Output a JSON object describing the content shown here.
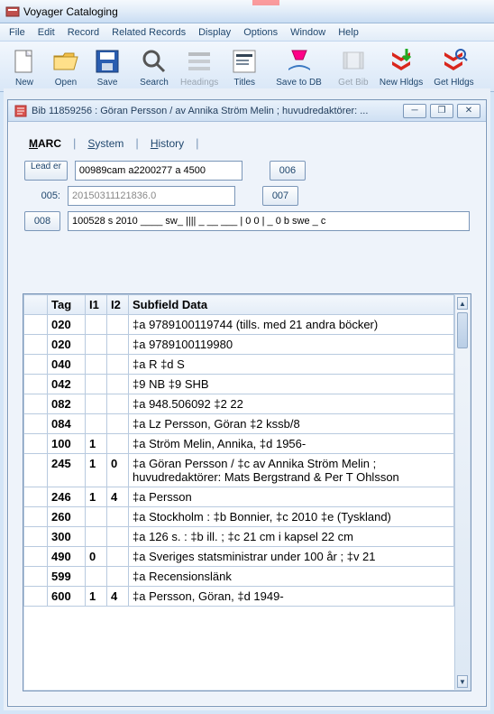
{
  "app_title": "Voyager Cataloging",
  "menus": [
    "File",
    "Edit",
    "Record",
    "Related Records",
    "Display",
    "Options",
    "Window",
    "Help"
  ],
  "toolbar": [
    {
      "name": "new-button",
      "label": "New",
      "icon": "new",
      "enabled": true
    },
    {
      "name": "open-button",
      "label": "Open",
      "icon": "open",
      "enabled": true
    },
    {
      "name": "save-button",
      "label": "Save",
      "icon": "save",
      "enabled": true
    },
    {
      "name": "search-button",
      "label": "Search",
      "icon": "search",
      "enabled": true
    },
    {
      "name": "headings-button",
      "label": "Headings",
      "icon": "headings",
      "enabled": false
    },
    {
      "name": "titles-button",
      "label": "Titles",
      "icon": "titles",
      "enabled": true
    },
    {
      "name": "savetodb-button",
      "label": "Save to DB",
      "icon": "savetodb",
      "enabled": true
    },
    {
      "name": "getbib-button",
      "label": "Get Bib",
      "icon": "getbib",
      "enabled": false
    },
    {
      "name": "newhldgs-button",
      "label": "New Hldgs",
      "icon": "newhldgs",
      "enabled": true
    },
    {
      "name": "gethldgs-button",
      "label": "Get Hldgs",
      "icon": "gethldgs",
      "enabled": true
    }
  ],
  "child": {
    "title": "Bib 11859256 : Göran Persson / av Annika Ström Melin ; huvudredaktörer: ...",
    "tabs": [
      {
        "label": "MARC",
        "underline": "M",
        "selected": true
      },
      {
        "label": "System",
        "underline": "S",
        "selected": false
      },
      {
        "label": "History",
        "underline": "H",
        "selected": false
      }
    ],
    "leader_btn": "Lead er",
    "leader_val": "00989cam a2200277 a 4500",
    "btn_006": "006",
    "lbl_005": "005:",
    "val_005": "20150311121836.0",
    "btn_007": "007",
    "btn_008": "008",
    "val_008": "100528 s 2010 ____ sw_ |||| _ __ ___ | 0 0 | _ 0 b swe _ c",
    "columns": [
      "",
      "Tag",
      "I1",
      "I2",
      "Subfield Data"
    ],
    "rows": [
      {
        "tag": "020",
        "i1": "",
        "i2": "",
        "data": "‡a 9789100119744 (tills. med 21 andra böcker)"
      },
      {
        "tag": "020",
        "i1": "",
        "i2": "",
        "data": "‡a 9789100119980"
      },
      {
        "tag": "040",
        "i1": "",
        "i2": "",
        "data": "‡a R ‡d S"
      },
      {
        "tag": "042",
        "i1": "",
        "i2": "",
        "data": "‡9 NB ‡9 SHB"
      },
      {
        "tag": "082",
        "i1": "",
        "i2": "",
        "data": "‡a 948.506092 ‡2 22"
      },
      {
        "tag": "084",
        "i1": "",
        "i2": "",
        "data": "‡a Lz Persson, Göran ‡2 kssb/8"
      },
      {
        "tag": "100",
        "i1": "1",
        "i2": "",
        "data": "‡a Ström Melin, Annika, ‡d 1956-"
      },
      {
        "tag": "245",
        "i1": "1",
        "i2": "0",
        "data": "‡a Göran Persson / ‡c av Annika Ström Melin ; huvudredaktörer: Mats Bergstrand & Per T Ohlsson"
      },
      {
        "tag": "246",
        "i1": "1",
        "i2": "4",
        "data": "‡a Persson"
      },
      {
        "tag": "260",
        "i1": "",
        "i2": "",
        "data": "‡a Stockholm : ‡b Bonnier, ‡c 2010 ‡e (Tyskland)"
      },
      {
        "tag": "300",
        "i1": "",
        "i2": "",
        "data": "‡a 126 s. : ‡b ill. ; ‡c 21 cm i kapsel 22 cm"
      },
      {
        "tag": "490",
        "i1": "0",
        "i2": "",
        "data": "‡a Sveriges statsministrar under 100 år ; ‡v 21"
      },
      {
        "tag": "599",
        "i1": "",
        "i2": "",
        "data": "‡a Recensionslänk"
      },
      {
        "tag": "600",
        "i1": "1",
        "i2": "4",
        "data": "‡a Persson, Göran, ‡d 1949-"
      }
    ]
  }
}
